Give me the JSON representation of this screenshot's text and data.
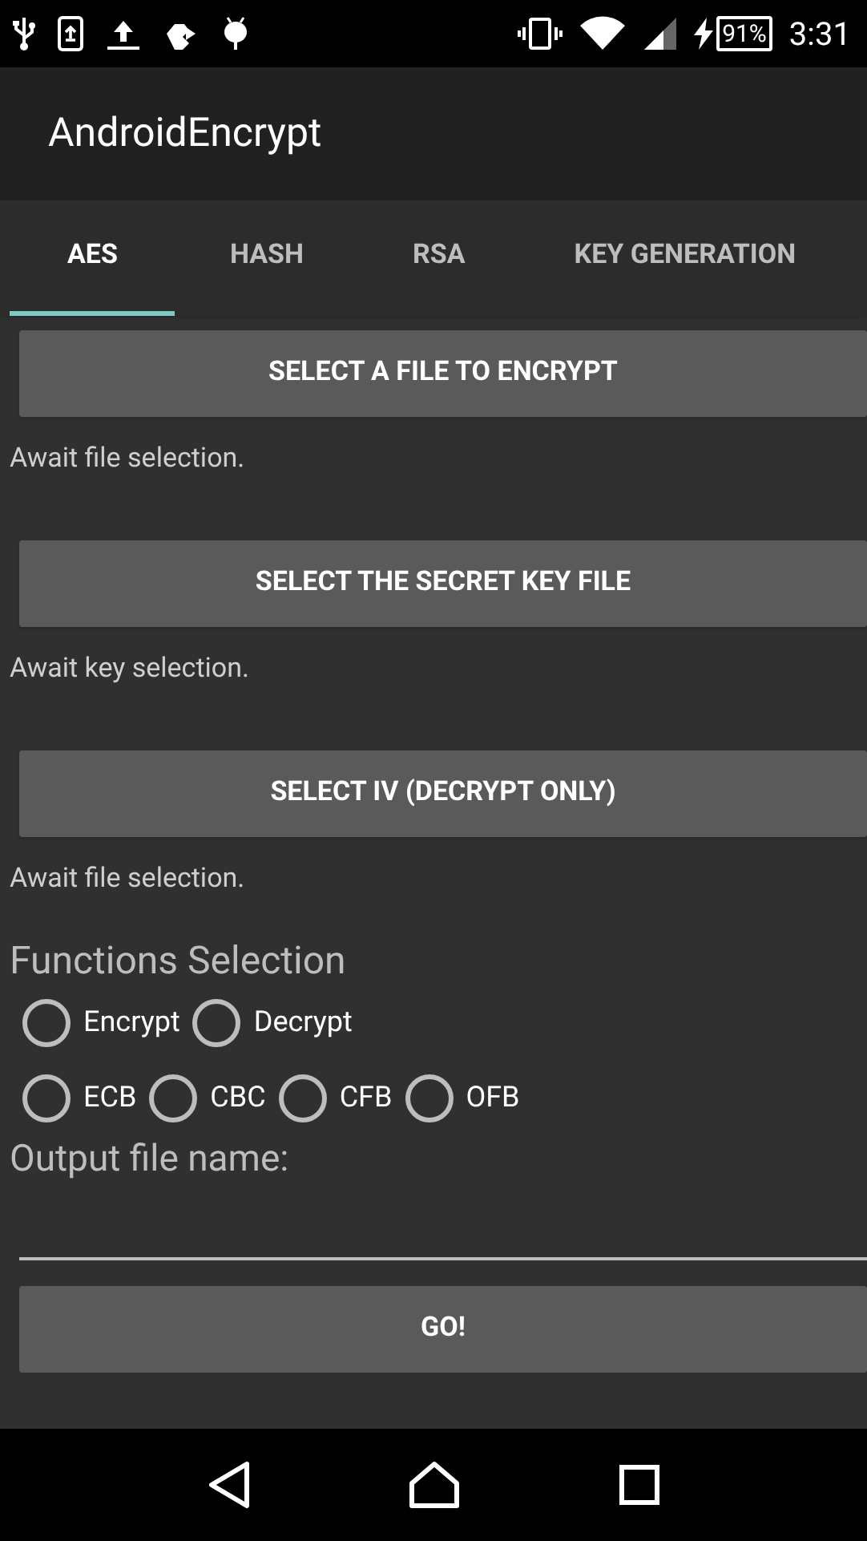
{
  "status_bar": {
    "battery": "91%",
    "time": "3:31"
  },
  "app_bar": {
    "title": "AndroidEncrypt"
  },
  "tabs": [
    {
      "label": "AES",
      "selected": true
    },
    {
      "label": "HASH",
      "selected": false
    },
    {
      "label": "RSA",
      "selected": false
    },
    {
      "label": "KEY GENERATION",
      "selected": false
    }
  ],
  "sections": [
    {
      "button": "SELECT A FILE TO ENCRYPT",
      "status": "Await file selection."
    },
    {
      "button": "SELECT THE SECRET KEY FILE",
      "status": "Await key selection."
    },
    {
      "button": "SELECT IV (DECRYPT ONLY)",
      "status": "Await file selection."
    }
  ],
  "functions": {
    "title": "Functions Selection",
    "groups": [
      [
        {
          "label": "Encrypt",
          "selected": false
        },
        {
          "label": "Decrypt",
          "selected": false
        }
      ],
      [
        {
          "label": "ECB",
          "selected": false
        },
        {
          "label": "CBC",
          "selected": false
        },
        {
          "label": "CFB",
          "selected": false
        },
        {
          "label": "OFB",
          "selected": false
        }
      ]
    ]
  },
  "output": {
    "label": "Output file name:"
  },
  "go_button": "GO!"
}
